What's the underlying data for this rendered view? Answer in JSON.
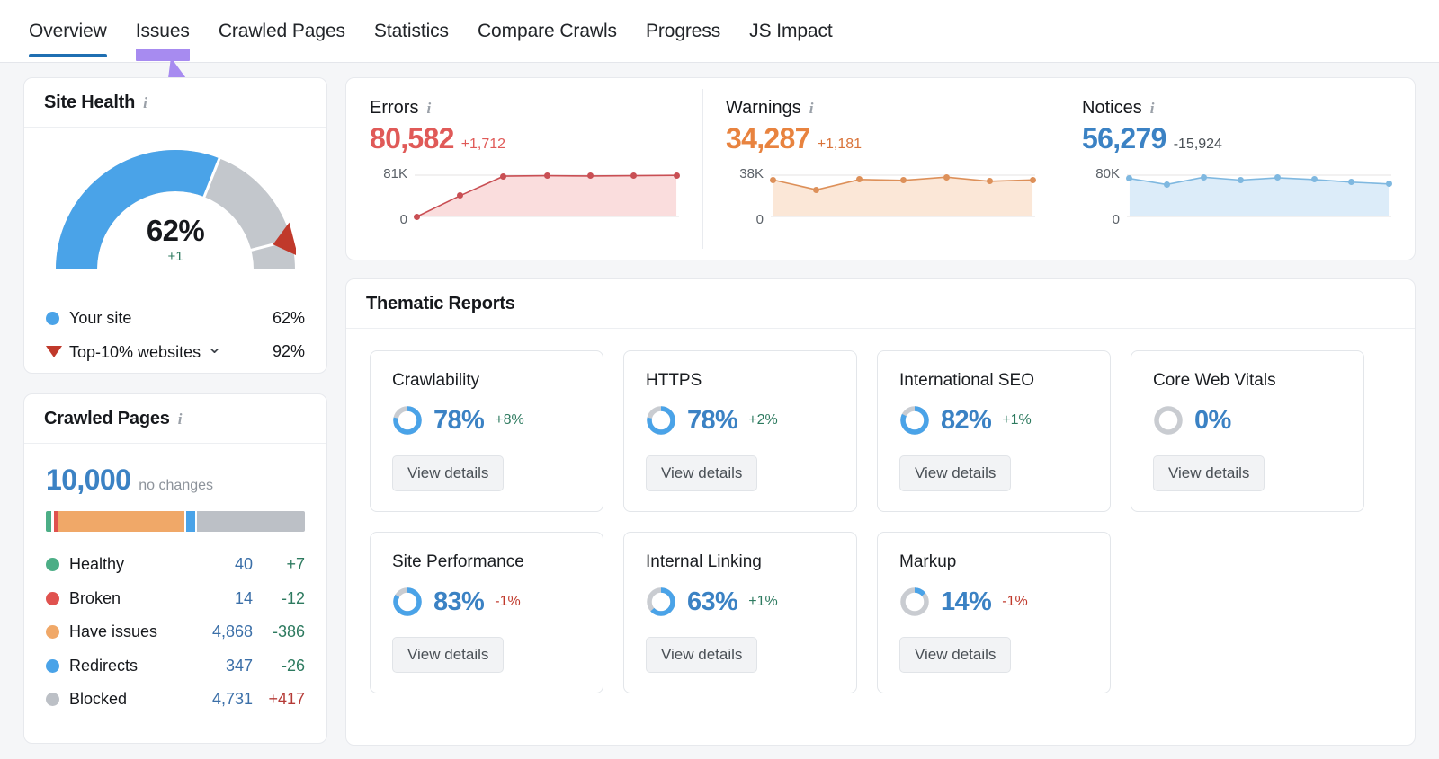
{
  "tabs": [
    {
      "label": "Overview",
      "state": "active"
    },
    {
      "label": "Issues",
      "state": "highlight"
    },
    {
      "label": "Crawled Pages",
      "state": "normal"
    },
    {
      "label": "Statistics",
      "state": "normal"
    },
    {
      "label": "Compare Crawls",
      "state": "normal"
    },
    {
      "label": "Progress",
      "state": "normal"
    },
    {
      "label": "JS Impact",
      "state": "normal"
    }
  ],
  "annotation": {
    "type": "arrow",
    "color": "#a78bf0",
    "points_to": "Issues"
  },
  "site_health": {
    "title": "Site Health",
    "info_icon": "info-icon",
    "value": "62%",
    "delta": "+1",
    "gauge": {
      "your_site_pct": 62,
      "benchmark_pct": 92,
      "fill_color": "#4aa3e8",
      "track_color": "#c3c7cc",
      "marker_color": "#c0392b"
    },
    "legend": [
      {
        "marker": "dot",
        "color": "#4aa3e8",
        "label": "Your site",
        "value": "62%",
        "has_chevron": false
      },
      {
        "marker": "triangle",
        "color": "#c0392b",
        "label": "Top-10% websites",
        "value": "92%",
        "has_chevron": true
      }
    ]
  },
  "crawled_pages": {
    "title": "Crawled Pages",
    "info_icon": "info-icon",
    "total": "10,000",
    "total_note": "no changes",
    "bar_segments": [
      {
        "name": "Healthy",
        "color": "#4cae86",
        "width_pct": 2.2
      },
      {
        "name": "gap",
        "color": "#ffffff",
        "width_pct": 0.8
      },
      {
        "name": "Broken",
        "color": "#e0524f",
        "width_pct": 1.9
      },
      {
        "name": "Have issues",
        "color": "#f0a868",
        "width_pct": 48.7
      },
      {
        "name": "gap2",
        "color": "#ffffff",
        "width_pct": 0.7
      },
      {
        "name": "Redirects",
        "color": "#4aa3e8",
        "width_pct": 3.5
      },
      {
        "name": "gap3",
        "color": "#ffffff",
        "width_pct": 0.7
      },
      {
        "name": "Blocked",
        "color": "#bcc0c6",
        "width_pct": 41.5
      }
    ],
    "rows": [
      {
        "color": "#4cae86",
        "label": "Healthy",
        "count": "40",
        "delta": "+7",
        "delta_tone": "good"
      },
      {
        "color": "#e0524f",
        "label": "Broken",
        "count": "14",
        "delta": "-12",
        "delta_tone": "good"
      },
      {
        "color": "#f0a868",
        "label": "Have issues",
        "count": "4,868",
        "delta": "-386",
        "delta_tone": "good"
      },
      {
        "color": "#4aa3e8",
        "label": "Redirects",
        "count": "347",
        "delta": "-26",
        "delta_tone": "good"
      },
      {
        "color": "#bcc0c6",
        "label": "Blocked",
        "count": "4,731",
        "delta": "+417",
        "delta_tone": "bad"
      }
    ]
  },
  "kpis": [
    {
      "label": "Errors",
      "info_icon": "info-icon",
      "value": "80,582",
      "delta": "+1,712",
      "value_color": "#e05a58",
      "delta_color": "#e05a58",
      "line_color": "#c94f54",
      "fill_color": "#fadddd",
      "axis_top": "81K",
      "axis_bottom": "0"
    },
    {
      "label": "Warnings",
      "info_icon": "info-icon",
      "value": "34,287",
      "delta": "+1,181",
      "value_color": "#e8833f",
      "delta_color": "#d9733a",
      "line_color": "#dd9059",
      "fill_color": "#fbe7d7",
      "axis_top": "38K",
      "axis_bottom": "0"
    },
    {
      "label": "Notices",
      "info_icon": "info-icon",
      "value": "56,279",
      "delta": "-15,924",
      "value_color": "#3b82c4",
      "delta_color": "#4a5056",
      "line_color": "#7fb8e0",
      "fill_color": "#dcecf9",
      "axis_top": "80K",
      "axis_bottom": "0"
    }
  ],
  "chart_data": [
    {
      "type": "area",
      "title": "Errors",
      "ylabel": "",
      "xlabel": "",
      "ylim": [
        0,
        81000
      ],
      "tick_labels": [
        "0",
        "81K"
      ],
      "grid": false,
      "legend": "none",
      "series": [
        {
          "name": "Errors",
          "values": [
            0,
            41000,
            79000,
            80000,
            79500,
            80000,
            80582
          ]
        }
      ]
    },
    {
      "type": "area",
      "title": "Warnings",
      "ylabel": "",
      "xlabel": "",
      "ylim": [
        0,
        38000
      ],
      "tick_labels": [
        "0",
        "38K"
      ],
      "grid": false,
      "legend": "none",
      "series": [
        {
          "name": "Warnings",
          "values": [
            33500,
            24500,
            34000,
            33200,
            36200,
            32400,
            33600
          ]
        }
      ]
    },
    {
      "type": "area",
      "title": "Notices",
      "ylabel": "",
      "xlabel": "",
      "ylim": [
        0,
        80000
      ],
      "tick_labels": [
        "0",
        "80K"
      ],
      "grid": false,
      "legend": "none",
      "series": [
        {
          "name": "Notices",
          "values": [
            73500,
            62000,
            76000,
            70500,
            75000,
            71500,
            66500,
            63000
          ]
        }
      ]
    },
    {
      "type": "pie",
      "title": "Site Health gauge",
      "categories": [
        "Your site",
        "Remaining"
      ],
      "values": [
        62,
        38
      ],
      "annotations": [
        "Top-10% websites benchmark at 92%"
      ]
    },
    {
      "type": "bar",
      "title": "Crawled Pages distribution",
      "categories": [
        "Healthy",
        "Broken",
        "Have issues",
        "Redirects",
        "Blocked"
      ],
      "values": [
        40,
        14,
        4868,
        347,
        4731
      ],
      "ylabel": "Pages",
      "xlabel": "",
      "grid": false
    }
  ],
  "thematic": {
    "title": "Thematic Reports",
    "button_label": "View details",
    "cards": [
      {
        "name": "Crawlability",
        "pct": "78%",
        "pct_value": 78,
        "delta": "+8%",
        "delta_tone": "good"
      },
      {
        "name": "HTTPS",
        "pct": "78%",
        "pct_value": 78,
        "delta": "+2%",
        "delta_tone": "good"
      },
      {
        "name": "International SEO",
        "pct": "82%",
        "pct_value": 82,
        "delta": "+1%",
        "delta_tone": "good"
      },
      {
        "name": "Core Web Vitals",
        "pct": "0%",
        "pct_value": 0,
        "delta": "",
        "delta_tone": "none"
      },
      {
        "name": "Site Performance",
        "pct": "83%",
        "pct_value": 83,
        "delta": "-1%",
        "delta_tone": "bad"
      },
      {
        "name": "Internal Linking",
        "pct": "63%",
        "pct_value": 63,
        "delta": "+1%",
        "delta_tone": "good"
      },
      {
        "name": "Markup",
        "pct": "14%",
        "pct_value": 14,
        "delta": "-1%",
        "delta_tone": "bad"
      }
    ]
  }
}
